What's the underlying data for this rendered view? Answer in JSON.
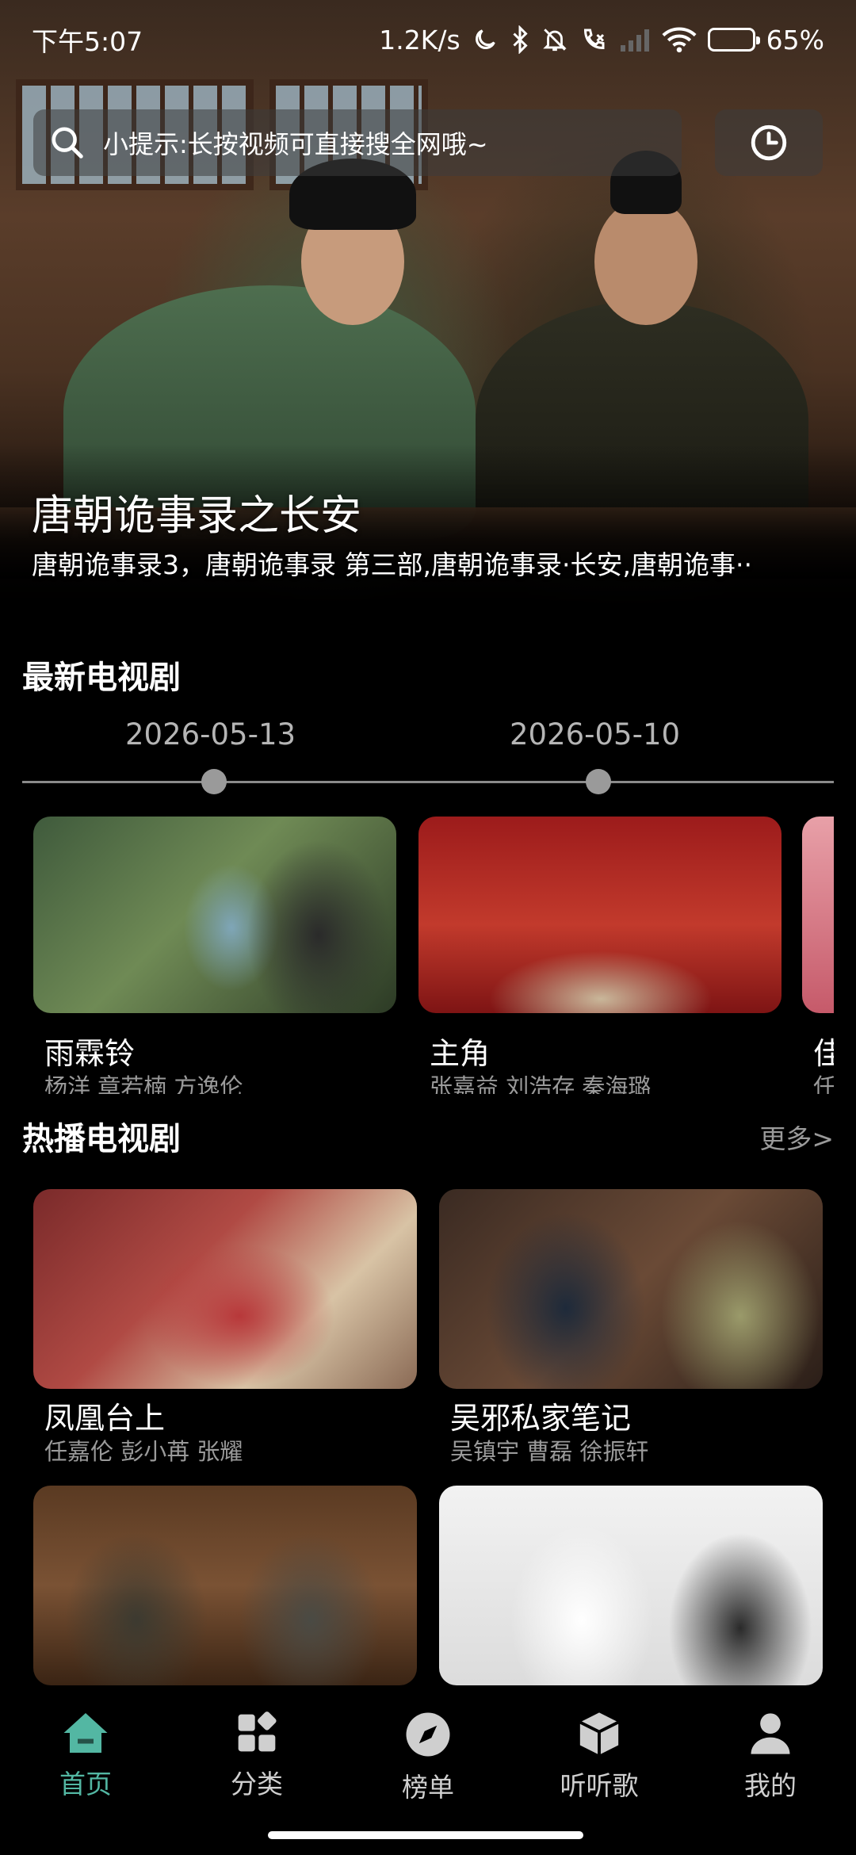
{
  "status_bar": {
    "time": "下午5:07",
    "net_speed": "1.2K/s",
    "battery": "65%",
    "battery_level": 0.65
  },
  "hero": {
    "search_placeholder": "小提示:长按视频可直接搜全网哦~",
    "title": "唐朝诡事录之长安",
    "subtitle": "唐朝诡事录3，唐朝诡事录 第三部,唐朝诡事录·长安,唐朝诡事··"
  },
  "latest": {
    "section_title": "最新电视剧",
    "dates": [
      "2026-05-13",
      "2026-05-10"
    ],
    "items": [
      {
        "title": "雨霖铃",
        "actors": "杨洋 章若楠 方逸伦"
      },
      {
        "title": "主角",
        "actors": "张嘉益 刘浩存 秦海璐"
      },
      {
        "title": "佳",
        "actors": "任"
      }
    ]
  },
  "hot": {
    "section_title": "热播电视剧",
    "more_label": "更多>",
    "items": [
      {
        "title": "凤凰台上",
        "actors": "任嘉伦 彭小苒 张耀"
      },
      {
        "title": "吴邪私家笔记",
        "actors": "吴镇宇 曹磊 徐振轩"
      },
      {
        "title": "",
        "actors": ""
      },
      {
        "title": "",
        "actors": ""
      }
    ]
  },
  "bottom_nav": {
    "items": [
      {
        "label": "首页",
        "icon": "home-icon",
        "active": true
      },
      {
        "label": "分类",
        "icon": "category-icon",
        "active": false
      },
      {
        "label": "榜单",
        "icon": "compass-icon",
        "active": false
      },
      {
        "label": "听听歌",
        "icon": "cube-icon",
        "active": false
      },
      {
        "label": "我的",
        "icon": "user-icon",
        "active": false
      }
    ]
  },
  "colors": {
    "accent": "#53b7a3",
    "background": "#000000",
    "secondary_text": "#9a9a9a"
  }
}
